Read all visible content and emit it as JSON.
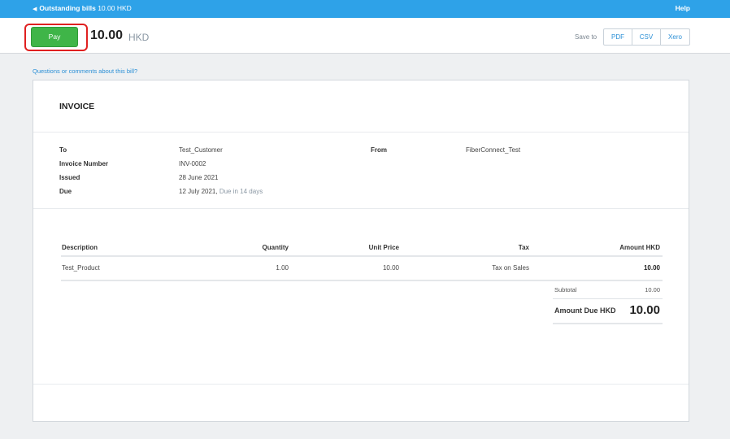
{
  "topbar": {
    "back_label": "Outstanding bills",
    "back_amount": "10.00 HKD",
    "help": "Help"
  },
  "header": {
    "pay_label": "Pay",
    "amount": "10.00",
    "currency": "HKD",
    "save_to": "Save to",
    "save_buttons": [
      "PDF",
      "CSV",
      "Xero"
    ]
  },
  "questions_link": "Questions or comments about this bill?",
  "invoice": {
    "title": "INVOICE",
    "labels": {
      "to": "To",
      "invoice_number": "Invoice Number",
      "issued": "Issued",
      "due": "Due",
      "from": "From"
    },
    "to": "Test_Customer",
    "invoice_number": "INV-0002",
    "issued": "28 June 2021",
    "due_date": "12 July 2021,",
    "due_note": "Due in 14 days",
    "from": "FiberConnect_Test",
    "columns": [
      "Description",
      "Quantity",
      "Unit Price",
      "Tax",
      "Amount HKD"
    ],
    "rows": [
      {
        "description": "Test_Product",
        "quantity": "1.00",
        "unit_price": "10.00",
        "tax": "Tax on Sales",
        "amount": "10.00"
      }
    ],
    "subtotal_label": "Subtotal",
    "subtotal_value": "10.00",
    "amount_due_label": "Amount Due HKD",
    "amount_due_value": "10.00"
  },
  "colors": {
    "topbar": "#2ea2e8",
    "pay_button": "#3fb548",
    "highlight_outline": "#e02020",
    "link": "#2a8fd6"
  }
}
